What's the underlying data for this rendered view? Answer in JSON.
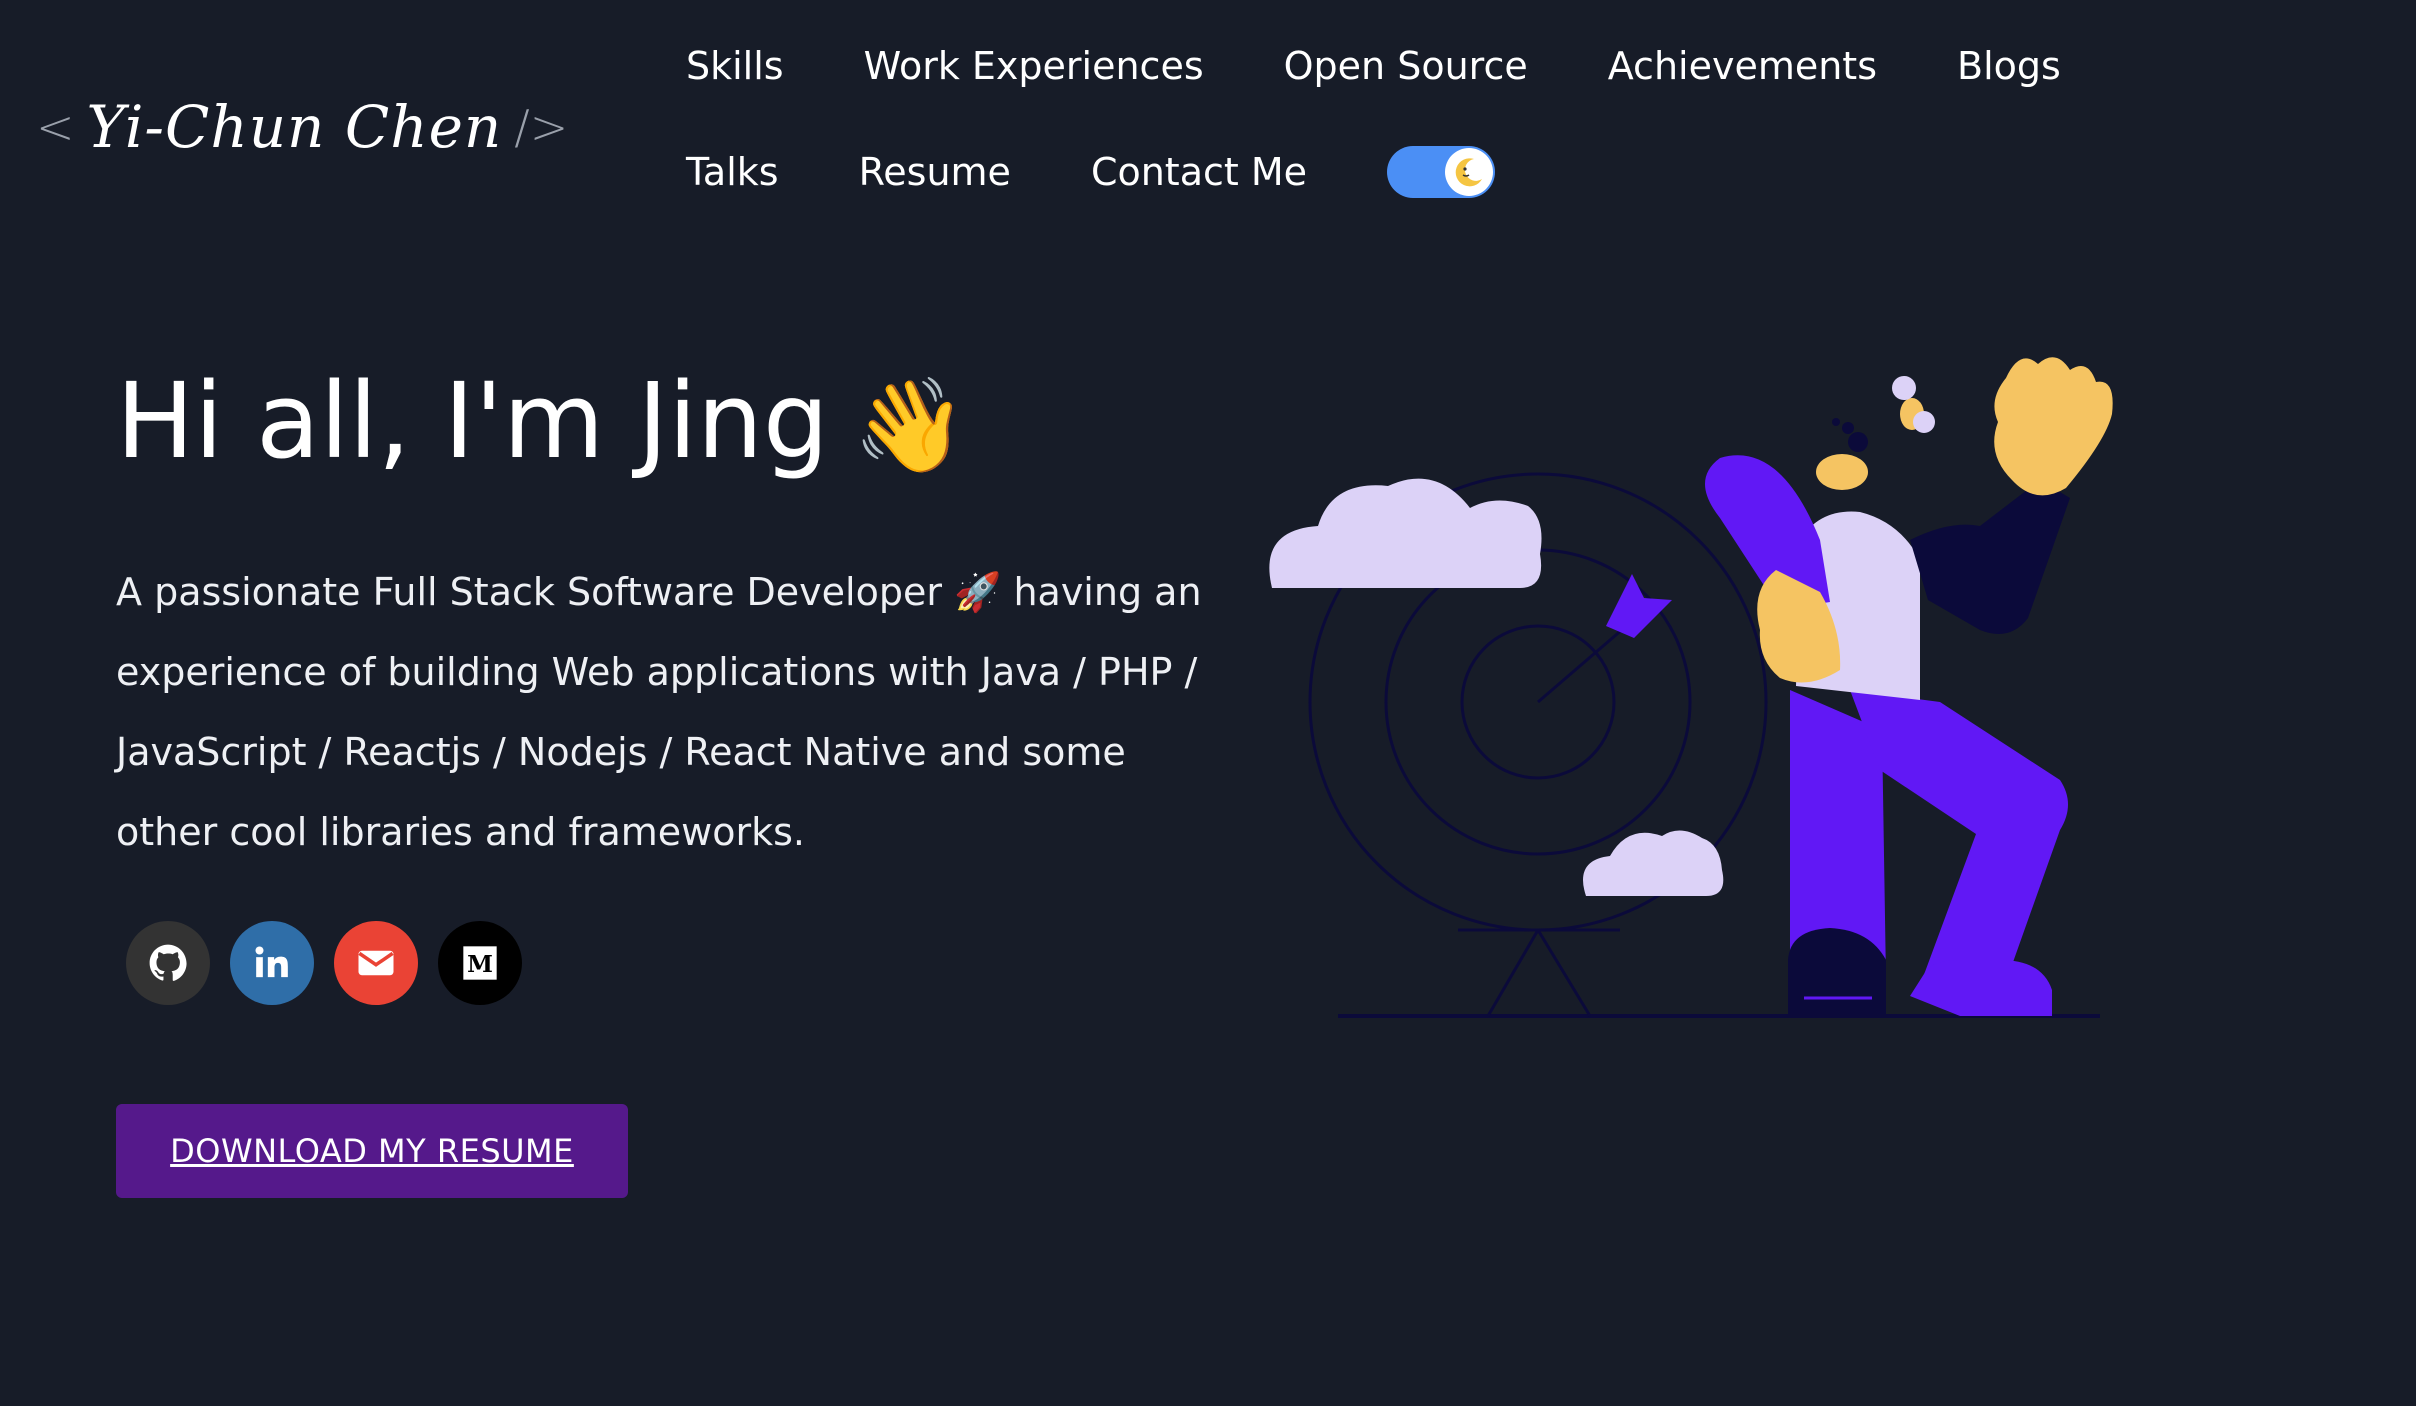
{
  "header": {
    "logo": {
      "open_bracket": "<",
      "signature": "Yi-Chun Chen",
      "close_bracket": "/>"
    },
    "nav": [
      {
        "label": "Skills"
      },
      {
        "label": "Work Experiences"
      },
      {
        "label": "Open Source"
      },
      {
        "label": "Achievements"
      },
      {
        "label": "Blogs"
      },
      {
        "label": "Talks"
      },
      {
        "label": "Resume"
      },
      {
        "label": "Contact Me"
      }
    ],
    "theme_toggle": {
      "state": "dark",
      "icon": "moon-icon",
      "accent": "#4b8ff5"
    }
  },
  "hero": {
    "title": "Hi all, I'm Jing",
    "title_emoji": "👋",
    "subtitle": "A passionate Full Stack Software Developer 🚀 having an experience of building Web applications with Java / PHP / JavaScript / Reactjs / Nodejs / React Native and some other cool libraries and frameworks.",
    "socials": [
      {
        "icon": "github-icon",
        "color": "#333333"
      },
      {
        "icon": "linkedin-icon",
        "color": "#2f6ea8"
      },
      {
        "icon": "gmail-icon",
        "color": "#ea4335"
      },
      {
        "icon": "medium-icon",
        "color": "#000000"
      }
    ],
    "download_button": "DOWNLOAD MY RESUME",
    "button_color": "#55198b"
  },
  "colors": {
    "background": "#171c28",
    "illustration_purple": "#6118f5",
    "illustration_lavender": "#dcd2f7",
    "illustration_skin": "#f5c462"
  }
}
